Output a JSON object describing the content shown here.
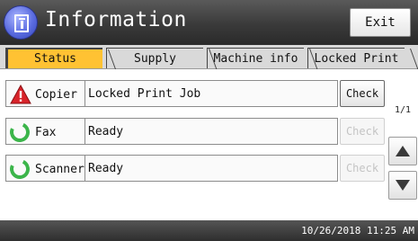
{
  "header": {
    "title": "Information",
    "exit_label": "Exit"
  },
  "tabs": [
    {
      "label": "Status",
      "active": true
    },
    {
      "label": "Supply",
      "active": false
    },
    {
      "label": "Machine info",
      "active": false
    },
    {
      "label": "Locked Print",
      "active": false
    }
  ],
  "rows": [
    {
      "device": "Copier",
      "status": "Locked Print Job",
      "icon": "warning-icon",
      "check_label": "Check",
      "check_enabled": true
    },
    {
      "device": "Fax",
      "status": "Ready",
      "icon": "ready-ring-icon",
      "check_label": "Check",
      "check_enabled": false
    },
    {
      "device": "Scanner",
      "status": "Ready",
      "icon": "ready-ring-icon",
      "check_label": "Check",
      "check_enabled": false
    }
  ],
  "pagination": {
    "indicator": "1/1"
  },
  "footer": {
    "datetime": "10/26/2018 11:25 AM"
  },
  "colors": {
    "active_tab": "#ffc233",
    "ready_green": "#3bb54a",
    "warning_red": "#d8232a"
  }
}
